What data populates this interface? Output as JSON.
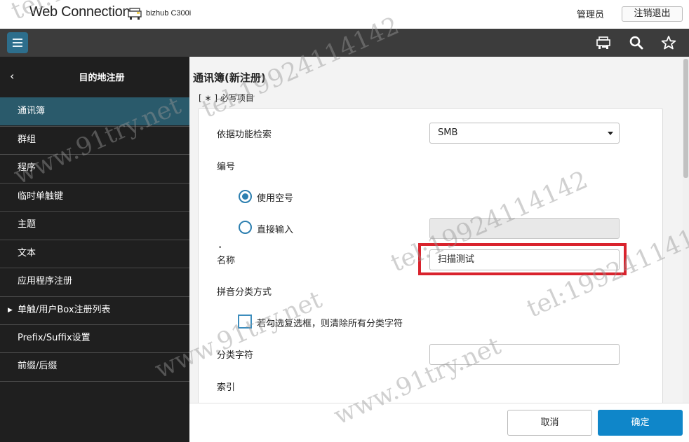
{
  "header": {
    "logo_text": "Web Connection",
    "model": "bizhub C300i",
    "user_label": "管理员",
    "logout_label": "注销退出"
  },
  "toolbar": {
    "icons": [
      "menu-icon",
      "printer-icon",
      "search-icon",
      "star-icon"
    ]
  },
  "sidebar": {
    "back_icon": "‹",
    "title": "目的地注册",
    "items": [
      {
        "label": "通讯簿",
        "active": true
      },
      {
        "label": "群组"
      },
      {
        "label": "程序"
      },
      {
        "label": "临时单触键"
      },
      {
        "label": "主题"
      },
      {
        "label": "文本"
      },
      {
        "label": "应用程序注册"
      },
      {
        "label": "单触/用户Box注册列表",
        "expandable": true,
        "caret": "▶"
      },
      {
        "label": "Prefix/Suffix设置"
      },
      {
        "label": "前缀/后缀"
      }
    ]
  },
  "main": {
    "title": "通讯簿(新注册)",
    "required_note": "[ ∗ ] 必写项目",
    "form": {
      "search_label": "依据功能检索",
      "search_value": "SMB",
      "number_label": "编号",
      "radio_use_empty": "使用空号",
      "radio_direct": "直接输入",
      "direct_value": "",
      "required_mark": "•",
      "name_label": "名称",
      "name_value": "扫描测试",
      "pinyin_label": "拼音分类方式",
      "checkbox_label": "若勾选复选框，则清除所有分类字符",
      "category_label": "分类字符",
      "category_value": "",
      "index_label": "索引"
    }
  },
  "footer": {
    "cancel_label": "取消",
    "ok_label": "确定"
  },
  "colors": {
    "accent": "#0f86c9",
    "sidebar_bg": "#1f1f1f",
    "sidebar_active": "#2a5a6b",
    "toolbar_bg": "#3c3c3c",
    "highlight": "#d9232d"
  },
  "watermark": {
    "text_a": "www.91try.net",
    "text_b": "tel:19924114142"
  }
}
